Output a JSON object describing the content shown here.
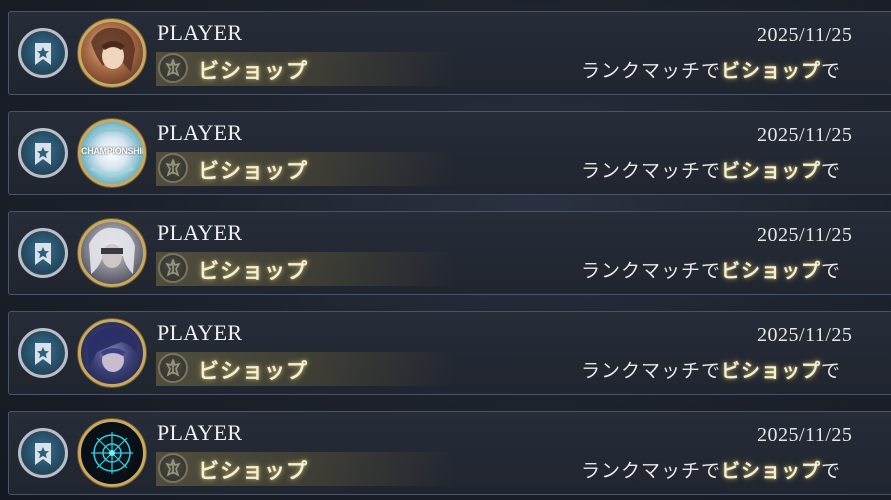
{
  "rows": [
    {
      "player": "PLAYER",
      "class_name": "ビショップ",
      "date": "2025/11/25",
      "desc_prefix": "ランクマッチで",
      "desc_highlight": "ビショップ",
      "desc_suffix": "で",
      "avatar": "character-portrait-brown-hair"
    },
    {
      "player": "PLAYER",
      "class_name": "ビショップ",
      "date": "2025/11/25",
      "desc_prefix": "ランクマッチで",
      "desc_highlight": "ビショップ",
      "desc_suffix": "で",
      "avatar": "championship-emblem",
      "avatar_text": "CHAMPIONSHIP"
    },
    {
      "player": "PLAYER",
      "class_name": "ビショップ",
      "date": "2025/11/25",
      "desc_prefix": "ランクマッチで",
      "desc_highlight": "ビショップ",
      "desc_suffix": "で",
      "avatar": "character-portrait-silver-hair"
    },
    {
      "player": "PLAYER",
      "class_name": "ビショップ",
      "date": "2025/11/25",
      "desc_prefix": "ランクマッチで",
      "desc_highlight": "ビショップ",
      "desc_suffix": "で",
      "avatar": "character-portrait-dark-blue"
    },
    {
      "player": "PLAYER",
      "class_name": "ビショップ",
      "date": "2025/11/25",
      "desc_prefix": "ランクマッチで",
      "desc_highlight": "ビショップ",
      "desc_suffix": "で",
      "avatar": "cyan-sigil-emblem"
    }
  ],
  "icons": {
    "favorite": "star-bookmark-icon",
    "class": "bishop-class-icon"
  },
  "colors": {
    "row_border": "#4b5466",
    "avatar_ring": "#c9a860",
    "favorite_fill": "#2e5e7a",
    "highlight_glow": "#c4b46a"
  }
}
